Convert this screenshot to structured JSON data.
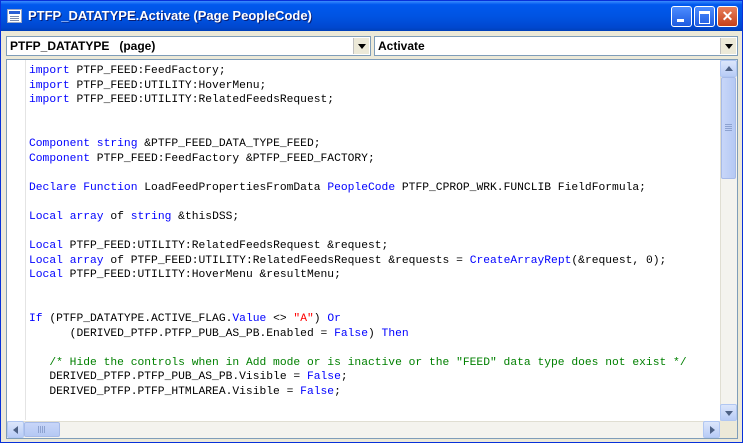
{
  "window": {
    "title": "PTFP_DATATYPE.Activate (Page PeopleCode)",
    "icon": "peoplecode-document-icon",
    "controls": {
      "minimize": "minimize-icon",
      "maximize": "maximize-icon",
      "close": "close-icon",
      "close_glyph": "✕"
    }
  },
  "toolbar": {
    "object_select": {
      "value": "PTFP_DATATYPE   (page)"
    },
    "event_select": {
      "value": "Activate"
    }
  },
  "editor": {
    "colors": {
      "keyword": "#0000FF",
      "string": "#FF0000",
      "comment": "#008000",
      "text": "#000000"
    },
    "lines": [
      [
        {
          "t": "kw",
          "v": "import"
        },
        {
          "t": "n",
          "v": " PTFP_FEED:FeedFactory;"
        }
      ],
      [
        {
          "t": "kw",
          "v": "import"
        },
        {
          "t": "n",
          "v": " PTFP_FEED:UTILITY:HoverMenu;"
        }
      ],
      [
        {
          "t": "kw",
          "v": "import"
        },
        {
          "t": "n",
          "v": " PTFP_FEED:UTILITY:RelatedFeedsRequest;"
        }
      ],
      [],
      [],
      [
        {
          "t": "kw",
          "v": "Component"
        },
        {
          "t": "n",
          "v": " "
        },
        {
          "t": "kw",
          "v": "string"
        },
        {
          "t": "n",
          "v": " &PTFP_FEED_DATA_TYPE_FEED;"
        }
      ],
      [
        {
          "t": "kw",
          "v": "Component"
        },
        {
          "t": "n",
          "v": " PTFP_FEED:FeedFactory &PTFP_FEED_FACTORY;"
        }
      ],
      [],
      [
        {
          "t": "kw",
          "v": "Declare"
        },
        {
          "t": "n",
          "v": " "
        },
        {
          "t": "kw",
          "v": "Function"
        },
        {
          "t": "n",
          "v": " LoadFeedPropertiesFromData "
        },
        {
          "t": "kw",
          "v": "PeopleCode"
        },
        {
          "t": "n",
          "v": " PTFP_CPROP_WRK.FUNCLIB FieldFormula;"
        }
      ],
      [],
      [
        {
          "t": "kw",
          "v": "Local"
        },
        {
          "t": "n",
          "v": " "
        },
        {
          "t": "kw",
          "v": "array"
        },
        {
          "t": "n",
          "v": " of "
        },
        {
          "t": "kw",
          "v": "string"
        },
        {
          "t": "n",
          "v": " &thisDSS;"
        }
      ],
      [],
      [
        {
          "t": "kw",
          "v": "Local"
        },
        {
          "t": "n",
          "v": " PTFP_FEED:UTILITY:RelatedFeedsRequest &request;"
        }
      ],
      [
        {
          "t": "kw",
          "v": "Local"
        },
        {
          "t": "n",
          "v": " "
        },
        {
          "t": "kw",
          "v": "array"
        },
        {
          "t": "n",
          "v": " of PTFP_FEED:UTILITY:RelatedFeedsRequest &requests = "
        },
        {
          "t": "kw",
          "v": "CreateArrayRept"
        },
        {
          "t": "n",
          "v": "(&request, 0);"
        }
      ],
      [
        {
          "t": "kw",
          "v": "Local"
        },
        {
          "t": "n",
          "v": " PTFP_FEED:UTILITY:HoverMenu &resultMenu;"
        }
      ],
      [],
      [],
      [
        {
          "t": "kw",
          "v": "If"
        },
        {
          "t": "n",
          "v": " (PTFP_DATATYPE.ACTIVE_FLAG."
        },
        {
          "t": "kw",
          "v": "Value"
        },
        {
          "t": "n",
          "v": " <> "
        },
        {
          "t": "str",
          "v": "\"A\""
        },
        {
          "t": "n",
          "v": ") "
        },
        {
          "t": "kw",
          "v": "Or"
        }
      ],
      [
        {
          "t": "n",
          "v": "      (DERIVED_PTFP.PTFP_PUB_AS_PB.Enabled = "
        },
        {
          "t": "kw",
          "v": "False"
        },
        {
          "t": "n",
          "v": ") "
        },
        {
          "t": "kw",
          "v": "Then"
        }
      ],
      [],
      [
        {
          "t": "n",
          "v": "   "
        },
        {
          "t": "cmt",
          "v": "/* Hide the controls when in Add mode or is inactive or the \"FEED\" data type does not exist */"
        }
      ],
      [
        {
          "t": "n",
          "v": "   DERIVED_PTFP.PTFP_PUB_AS_PB.Visible = "
        },
        {
          "t": "kw",
          "v": "False"
        },
        {
          "t": "n",
          "v": ";"
        }
      ],
      [
        {
          "t": "n",
          "v": "   DERIVED_PTFP.PTFP_HTMLAREA.Visible = "
        },
        {
          "t": "kw",
          "v": "False"
        },
        {
          "t": "n",
          "v": ";"
        }
      ],
      []
    ]
  },
  "scrollbars": {
    "vertical": {
      "up": "scroll-up-arrow-icon",
      "down": "scroll-down-arrow-icon"
    },
    "horizontal": {
      "left": "scroll-left-arrow-icon",
      "right": "scroll-right-arrow-icon"
    }
  }
}
